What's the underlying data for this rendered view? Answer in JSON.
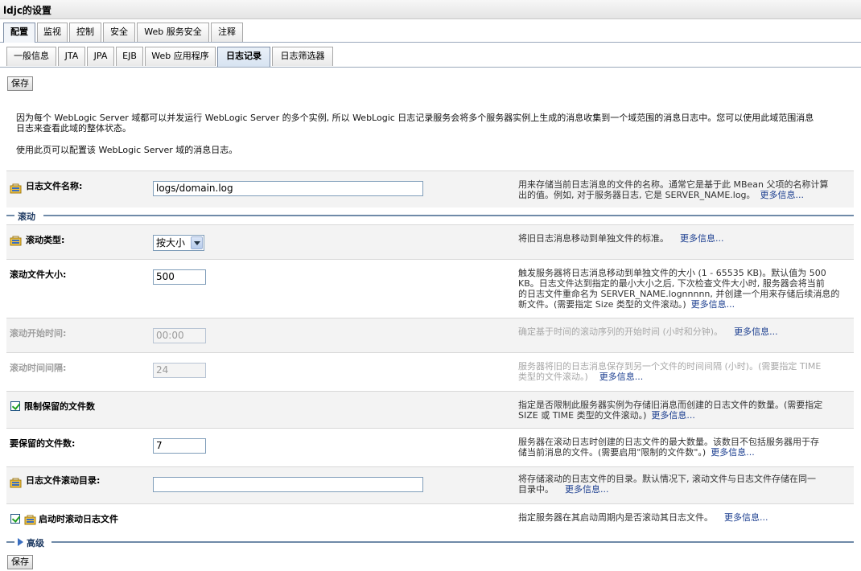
{
  "window": {
    "title": "ldjc的设置"
  },
  "main_tabs": [
    {
      "label": "配置"
    },
    {
      "label": "监视"
    },
    {
      "label": "控制"
    },
    {
      "label": "安全"
    },
    {
      "label": "Web 服务安全"
    },
    {
      "label": "注释"
    }
  ],
  "sub_tabs": [
    {
      "label": "一般信息"
    },
    {
      "label": "JTA"
    },
    {
      "label": "JPA"
    },
    {
      "label": "EJB"
    },
    {
      "label": "Web 应用程序"
    },
    {
      "label": "日志记录"
    },
    {
      "label": "日志筛选器"
    }
  ],
  "save_label": "保存",
  "intro": {
    "line1": "因为每个 WebLogic Server 域都可以并发运行 WebLogic Server 的多个实例, 所以 WebLogic 日志记录服务会将多个服务器实例上生成的消息收集到一个域范围的消息日志中。您可以使用此域范围消息",
    "line2": "日志来查看此域的整体状态。",
    "line3": "使用此页可以配置该 WebLogic Server 域的消息日志。"
  },
  "more": "更多信息...",
  "fields": {
    "log_file_name": {
      "label": "日志文件名称:",
      "value": "logs/domain.log",
      "help1": "用来存储当前日志消息的文件的名称。通常它是基于此 MBean 父项的名称计算",
      "help2": "出的值。例如, 对于服务器日志, 它是 SERVER_NAME.log。"
    },
    "rotation_type": {
      "label": "滚动类型:",
      "value": "按大小",
      "help": "将旧日志消息移动到单独文件的标准。"
    },
    "rotation_size": {
      "label": "滚动文件大小:",
      "value": "500",
      "help1": "触发服务器将日志消息移动到单独文件的大小 (1 - 65535 KB)。默认值为 500",
      "help2": "KB。日志文件达到指定的最小大小之后, 下次检查文件大小时, 服务器会将当前",
      "help3": "的日志文件重命名为 SERVER_NAME.lognnnnn, 并创建一个用来存储后续消息的",
      "help4": "新文件。(需要指定 Size 类型的文件滚动。)"
    },
    "rotation_start_time": {
      "label": "滚动开始时间:",
      "value": "00:00",
      "help": "确定基于时间的滚动序列的开始时间 (小时和分钟)。"
    },
    "rotation_interval": {
      "label": "滚动时间间隔:",
      "value": "24",
      "help1": "服务器将旧的日志消息保存到另一个文件的时间间隔 (小时)。(需要指定 TIME",
      "help2": "类型的文件滚动。)"
    },
    "limit_files": {
      "label": "限制保留的文件数",
      "checked": true,
      "help1": "指定是否限制此服务器实例为存储旧消息而创建的日志文件的数量。(需要指定",
      "help2": "SIZE 或 TIME 类型的文件滚动。)"
    },
    "files_to_retain": {
      "label": "要保留的文件数:",
      "value": "7",
      "help1": "服务器在滚动日志时创建的日志文件的最大数量。该数目不包括服务器用于存",
      "help2": "储当前消息的文件。(需要启用\"限制的文件数\"。)"
    },
    "rotation_dir": {
      "label": "日志文件滚动目录:",
      "value": "",
      "help1": "将存储滚动的日志文件的目录。默认情况下, 滚动文件与日志文件存储在同一",
      "help2": "目录中。"
    },
    "rotate_on_startup": {
      "label": "启动时滚动日志文件",
      "checked": true,
      "help": "指定服务器在其启动周期内是否滚动其日志文件。"
    }
  },
  "sections": {
    "rotation": "滚动",
    "advanced": "高级"
  }
}
